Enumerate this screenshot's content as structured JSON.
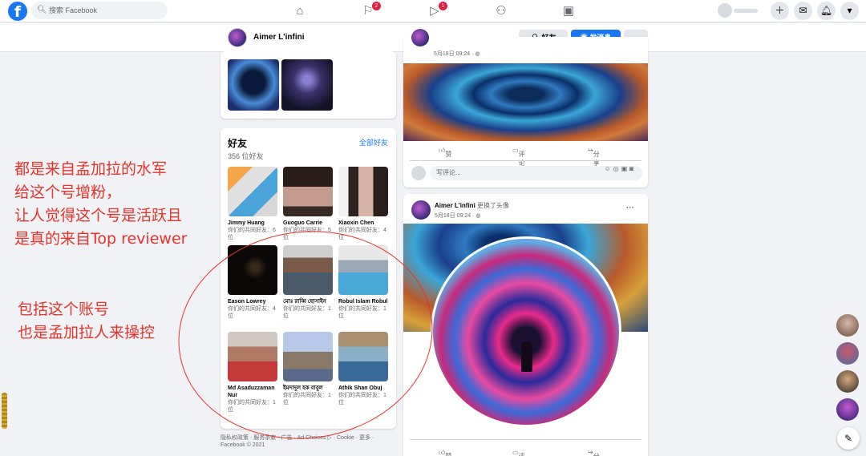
{
  "nav": {
    "logo": "f",
    "search_placeholder": "搜索 Facebook",
    "badges": {
      "pages": "2",
      "watch": "1"
    }
  },
  "profile_header": {
    "name": "Aimer L'infini",
    "friend_button": "好友",
    "message_button": "发消息",
    "more_button": "···"
  },
  "friends": {
    "title": "好友",
    "count": "356 位好友",
    "see_all": "全部好友",
    "items": [
      {
        "name": "Jimmy Huang",
        "mutual": "你们的共同好友：6 位"
      },
      {
        "name": "Guoguo Carrie",
        "mutual": "你们的共同好友：5 位"
      },
      {
        "name": "Xiaoxin Chen",
        "mutual": "你们的共同好友：4 位"
      },
      {
        "name": "Eason Lowrey",
        "mutual": "你们的共同好友：4 位"
      },
      {
        "name": "মোঃ রাব্বি হোসাইন",
        "mutual": "你们的共同好友：1 位"
      },
      {
        "name": "Robul Islam Robul",
        "mutual": "你们的共同好友：1 位"
      },
      {
        "name": "Md Asaduzzaman Nur",
        "mutual": "你们的共同好友：1 位"
      },
      {
        "name": "ইমদাদুল হক বাবুল",
        "mutual": "你们的共同好友：1 位"
      },
      {
        "name": "Athik Shan Obuj",
        "mutual": "你们的共同好友：1 位"
      }
    ]
  },
  "footer": {
    "line1": "隐私权政策 · 服务条款 · 广告 · Ad Choices ▷ · Cookie · 更多 ·",
    "line2": "Facebook © 2021"
  },
  "post1": {
    "time": "5月18日 09:24 · ◍",
    "like": "赞",
    "comment": "评论",
    "share": "分享",
    "comment_placeholder": "写评论..."
  },
  "post2": {
    "name": "Aimer L'infini",
    "action": "更换了头像",
    "time": "5月18日 09:24 · ◍",
    "more": "···",
    "like": "赞",
    "comment": "评论",
    "share": "分享"
  },
  "annotations": {
    "block1": [
      "都是来自孟加拉的水军",
      "给这个号增粉，",
      "让人觉得这个号是活跃且",
      "是真的来自Top reviewer"
    ],
    "block2": [
      "包括这个账号",
      "也是孟加拉人来操控"
    ]
  },
  "colors": {
    "brand": "#1877f2",
    "annotation": "#e8332d",
    "badge": "#e41e3f"
  }
}
